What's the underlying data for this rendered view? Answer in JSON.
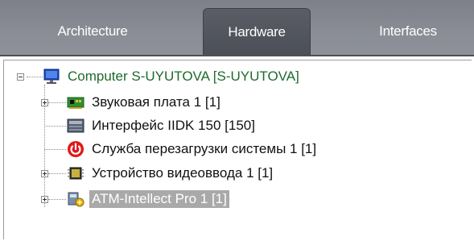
{
  "tabs": [
    {
      "label": "Architecture",
      "active": false
    },
    {
      "label": "Hardware",
      "active": true
    },
    {
      "label": "Interfaces",
      "active": false
    }
  ],
  "tree": {
    "root": {
      "label": "Computer S-UYUTOVA [S-UYUTOVA]",
      "icon": "computer-icon",
      "expanded": true
    },
    "children": [
      {
        "label": "Звуковая плата 1 [1]",
        "icon": "sound-card-icon",
        "expandable": true
      },
      {
        "label": "Интерфейс IIDK 150 [150]",
        "icon": "iidk-interface-icon",
        "expandable": false
      },
      {
        "label": "Служба перезагрузки системы 1 [1]",
        "icon": "power-icon",
        "expandable": false
      },
      {
        "label": "Устройство видеоввода 1 [1]",
        "icon": "video-capture-icon",
        "expandable": true
      },
      {
        "label": "ATM-Intellect Pro 1 [1]",
        "icon": "atm-intellect-icon",
        "expandable": true,
        "selected": true
      }
    ]
  },
  "colors": {
    "tabbar_bg": "#8a8d95",
    "active_tab_bg": "#4c4f58",
    "root_text": "#1d6b2d",
    "selection_bg": "#a9a9a9"
  }
}
